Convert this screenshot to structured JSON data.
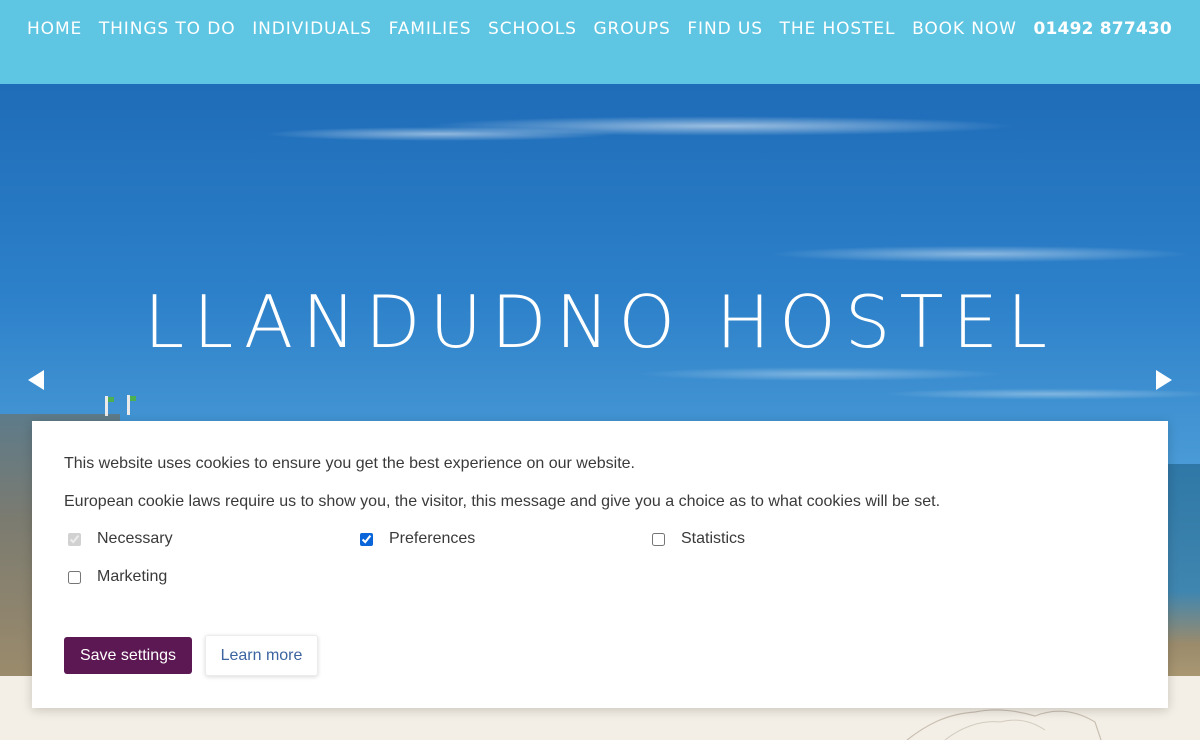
{
  "nav": {
    "items": [
      "HOME",
      "THINGS TO DO",
      "INDIVIDUALS",
      "FAMILIES",
      "SCHOOLS",
      "GROUPS",
      "FIND US",
      "THE HOSTEL",
      "BOOK NOW"
    ],
    "phone": "01492 877430"
  },
  "hero": {
    "title": "LLANDUDNO HOSTEL",
    "prev_icon": "arrow-left-icon",
    "next_icon": "arrow-right-icon"
  },
  "cookie": {
    "message": "This website uses cookies to ensure you get the best experience on our website.",
    "law_notice": "European cookie laws require us to show you, the visitor, this message and give you a choice as to what cookies will be set.",
    "options": [
      {
        "label": "Necessary",
        "checked": true,
        "disabled": true
      },
      {
        "label": "Preferences",
        "checked": true,
        "disabled": false
      },
      {
        "label": "Statistics",
        "checked": false,
        "disabled": false
      },
      {
        "label": "Marketing",
        "checked": false,
        "disabled": false
      }
    ],
    "save_label": "Save settings",
    "learn_label": "Learn more"
  },
  "colors": {
    "nav_bg": "#5ec5e2",
    "save_button_bg": "#5c1853",
    "learn_link": "#3c64a0"
  }
}
